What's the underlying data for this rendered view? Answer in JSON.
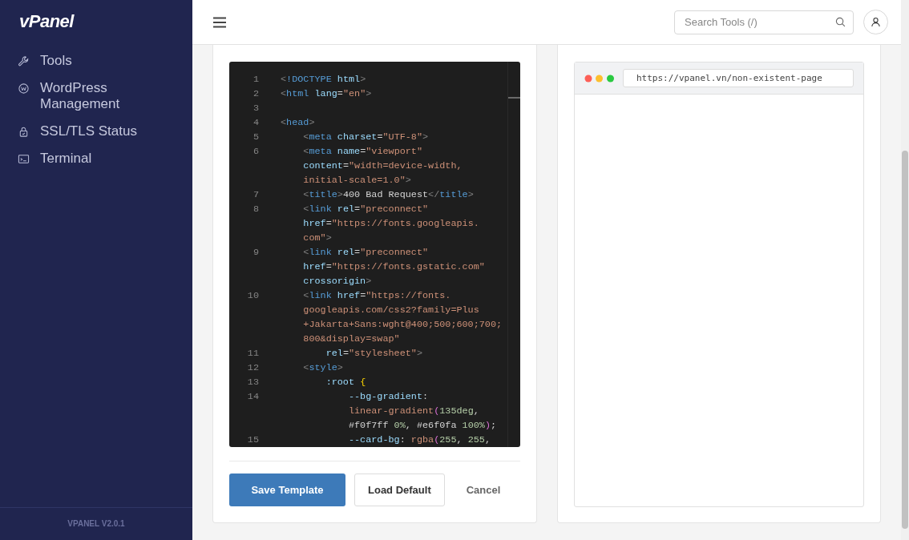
{
  "sidebar": {
    "logo": "vPanel",
    "items": [
      {
        "label": "Tools"
      },
      {
        "label": "WordPress Management"
      },
      {
        "label": "SSL/TLS Status"
      },
      {
        "label": "Terminal"
      }
    ],
    "version": "VPANEL V2.0.1"
  },
  "header": {
    "search": {
      "placeholder": "Search Tools (/)"
    }
  },
  "editor": {
    "lines": [
      {
        "number": "1",
        "tokens": [
          {
            "kind": "punct",
            "text": "<"
          },
          {
            "kind": "tag",
            "text": "!DOCTYPE"
          },
          {
            "kind": "attr",
            "text": " html"
          },
          {
            "kind": "punct",
            "text": ">"
          }
        ]
      },
      {
        "number": "2",
        "tokens": [
          {
            "kind": "punct",
            "text": "<"
          },
          {
            "kind": "tag",
            "text": "html"
          },
          {
            "kind": "attr",
            "text": " lang"
          },
          {
            "kind": "text",
            "text": "="
          },
          {
            "kind": "str",
            "text": "\"en\""
          },
          {
            "kind": "punct",
            "text": ">"
          }
        ]
      },
      {
        "number": "3"
      },
      {
        "number": "4",
        "tokens": [
          {
            "kind": "punct",
            "text": "<"
          },
          {
            "kind": "tag",
            "text": "head"
          },
          {
            "kind": "punct",
            "text": ">"
          }
        ]
      },
      {
        "number": "5",
        "tokens": [
          {
            "kind": "punct",
            "text": "    <"
          },
          {
            "kind": "tag",
            "text": "meta"
          },
          {
            "kind": "attr",
            "text": " charset"
          },
          {
            "kind": "text",
            "text": "="
          },
          {
            "kind": "str",
            "text": "\"UTF-8\""
          },
          {
            "kind": "punct",
            "text": ">"
          }
        ]
      },
      {
        "number": "6",
        "tokens": [
          {
            "kind": "punct",
            "text": "    <"
          },
          {
            "kind": "tag",
            "text": "meta"
          },
          {
            "kind": "attr",
            "text": " name"
          },
          {
            "kind": "text",
            "text": "="
          },
          {
            "kind": "str",
            "text": "\"viewport\""
          }
        ]
      },
      {
        "tokens": [
          {
            "kind": "attr",
            "text": "    content"
          },
          {
            "kind": "text",
            "text": "="
          },
          {
            "kind": "str",
            "text": "\"width=device-width,"
          }
        ]
      },
      {
        "tokens": [
          {
            "kind": "str",
            "text": "    initial-scale=1.0\""
          },
          {
            "kind": "punct",
            "text": ">"
          }
        ]
      },
      {
        "number": "7",
        "tokens": [
          {
            "kind": "punct",
            "text": "    <"
          },
          {
            "kind": "tag",
            "text": "title"
          },
          {
            "kind": "punct",
            "text": ">"
          },
          {
            "kind": "text",
            "text": "400 Bad Request"
          },
          {
            "kind": "punct",
            "text": "</"
          },
          {
            "kind": "tag",
            "text": "title"
          },
          {
            "kind": "punct",
            "text": ">"
          }
        ]
      },
      {
        "number": "8",
        "tokens": [
          {
            "kind": "punct",
            "text": "    <"
          },
          {
            "kind": "tag",
            "text": "link"
          },
          {
            "kind": "attr",
            "text": " rel"
          },
          {
            "kind": "text",
            "text": "="
          },
          {
            "kind": "str",
            "text": "\"preconnect\""
          }
        ]
      },
      {
        "tokens": [
          {
            "kind": "attr",
            "text": "    href"
          },
          {
            "kind": "text",
            "text": "="
          },
          {
            "kind": "str",
            "text": "\"https://fonts.googleapis."
          }
        ]
      },
      {
        "tokens": [
          {
            "kind": "str",
            "text": "    com\""
          },
          {
            "kind": "punct",
            "text": ">"
          }
        ]
      },
      {
        "number": "9",
        "tokens": [
          {
            "kind": "punct",
            "text": "    <"
          },
          {
            "kind": "tag",
            "text": "link"
          },
          {
            "kind": "attr",
            "text": " rel"
          },
          {
            "kind": "text",
            "text": "="
          },
          {
            "kind": "str",
            "text": "\"preconnect\""
          }
        ]
      },
      {
        "tokens": [
          {
            "kind": "attr",
            "text": "    href"
          },
          {
            "kind": "text",
            "text": "="
          },
          {
            "kind": "str",
            "text": "\"https://fonts.gstatic.com\""
          }
        ]
      },
      {
        "tokens": [
          {
            "kind": "attr",
            "text": "    crossorigin"
          },
          {
            "kind": "punct",
            "text": ">"
          }
        ]
      },
      {
        "number": "10",
        "tokens": [
          {
            "kind": "punct",
            "text": "    <"
          },
          {
            "kind": "tag",
            "text": "link"
          },
          {
            "kind": "attr",
            "text": " href"
          },
          {
            "kind": "text",
            "text": "="
          },
          {
            "kind": "str",
            "text": "\"https://fonts."
          }
        ]
      },
      {
        "tokens": [
          {
            "kind": "str",
            "text": "    googleapis.com/css2?family=Plus"
          }
        ]
      },
      {
        "tokens": [
          {
            "kind": "str",
            "text": "    +Jakarta+Sans:wght@400;500;600;700;"
          }
        ]
      },
      {
        "tokens": [
          {
            "kind": "str",
            "text": "    800&display=swap\""
          }
        ]
      },
      {
        "number": "11",
        "tokens": [
          {
            "kind": "attr",
            "text": "        rel"
          },
          {
            "kind": "text",
            "text": "="
          },
          {
            "kind": "str",
            "text": "\"stylesheet\""
          },
          {
            "kind": "punct",
            "text": ">"
          }
        ]
      },
      {
        "number": "12",
        "tokens": [
          {
            "kind": "punct",
            "text": "    <"
          },
          {
            "kind": "tag",
            "text": "style"
          },
          {
            "kind": "punct",
            "text": ">"
          }
        ]
      },
      {
        "number": "13",
        "tokens": [
          {
            "kind": "attr",
            "text": "        :root "
          },
          {
            "kind": "brace",
            "text": "{"
          }
        ]
      },
      {
        "number": "14",
        "tokens": [
          {
            "kind": "attr",
            "text": "            --bg-gradient"
          },
          {
            "kind": "text",
            "text": ":"
          }
        ]
      },
      {
        "tokens": [
          {
            "kind": "str",
            "text": "            linear-gradient"
          },
          {
            "kind": "paren",
            "text": "("
          },
          {
            "kind": "num",
            "text": "135deg"
          },
          {
            "kind": "text",
            "text": ","
          }
        ]
      },
      {
        "tokens": [
          {
            "kind": "text",
            "text": "            #f0f7ff "
          },
          {
            "kind": "num",
            "text": "0%"
          },
          {
            "kind": "text",
            "text": ", #e6f0fa "
          },
          {
            "kind": "num",
            "text": "100%"
          },
          {
            "kind": "paren",
            "text": ")"
          },
          {
            "kind": "text",
            "text": ";"
          }
        ]
      },
      {
        "number": "15",
        "tokens": [
          {
            "kind": "attr",
            "text": "            --card-bg"
          },
          {
            "kind": "text",
            "text": ": "
          },
          {
            "kind": "str",
            "text": "rgba"
          },
          {
            "kind": "paren",
            "text": "("
          },
          {
            "kind": "num",
            "text": "255"
          },
          {
            "kind": "text",
            "text": ", "
          },
          {
            "kind": "num",
            "text": "255"
          },
          {
            "kind": "text",
            "text": ","
          }
        ]
      }
    ]
  },
  "buttons": [
    {
      "kind": "primary",
      "label": "Save Template"
    },
    {
      "kind": "secondary",
      "label": "Load Default"
    },
    {
      "kind": "plain",
      "label": "Cancel"
    }
  ],
  "preview": {
    "url": "https://vpanel.vn/non-existent-page"
  }
}
